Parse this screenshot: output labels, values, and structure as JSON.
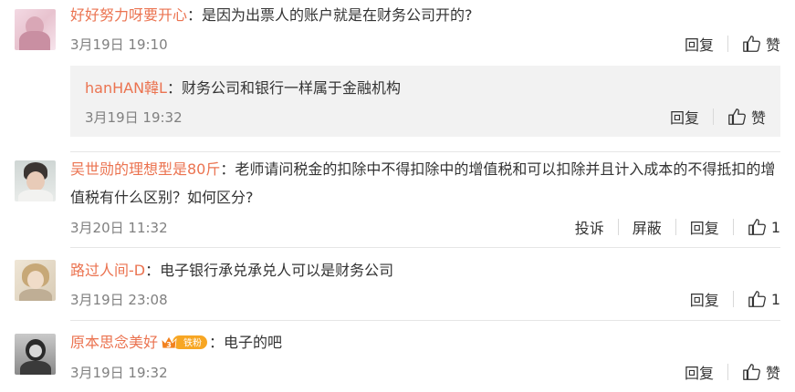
{
  "comments": [
    {
      "user": "好好努力呀要开心",
      "colon": "：",
      "text": "是因为出票人的账户就是在财务公司开的?",
      "time": "3月19日 19:10",
      "reply": "回复",
      "like": "赞",
      "sub_reply": {
        "user": "hanHAN韓L",
        "colon": "：",
        "text": "财务公司和银行一样属于金融机构",
        "time": "3月19日 19:32",
        "reply": "回复",
        "like": "赞"
      }
    },
    {
      "user": "吴世勋的理想型是80斤",
      "colon": "：",
      "text": "老师请问税金的扣除中不得扣除中的增值税和可以扣除并且计入成本的不得抵扣的增值税有什么区别？如何区分?",
      "time": "3月20日 11:32",
      "report": "投诉",
      "block": "屏蔽",
      "reply": "回复",
      "like": "1"
    },
    {
      "user": "路过人间-D",
      "colon": "：",
      "text": "电子银行承兑承兑人可以是财务公司",
      "time": "3月19日 23:08",
      "reply": "回复",
      "like": "1"
    },
    {
      "user": "原本思念美好",
      "badge_level": "3",
      "badge_text": "铁粉",
      "colon": "：",
      "text": "电子的吧",
      "time": "3月19日 19:32",
      "reply": "回复",
      "like": "赞"
    }
  ],
  "colors": {
    "username": "#eb7350",
    "meta": "#808080",
    "reply_bg": "#f2f2f2",
    "badge": "#f7a623"
  },
  "icons": [
    "thumbs-up-icon",
    "fan-badge-crown-icon"
  ]
}
